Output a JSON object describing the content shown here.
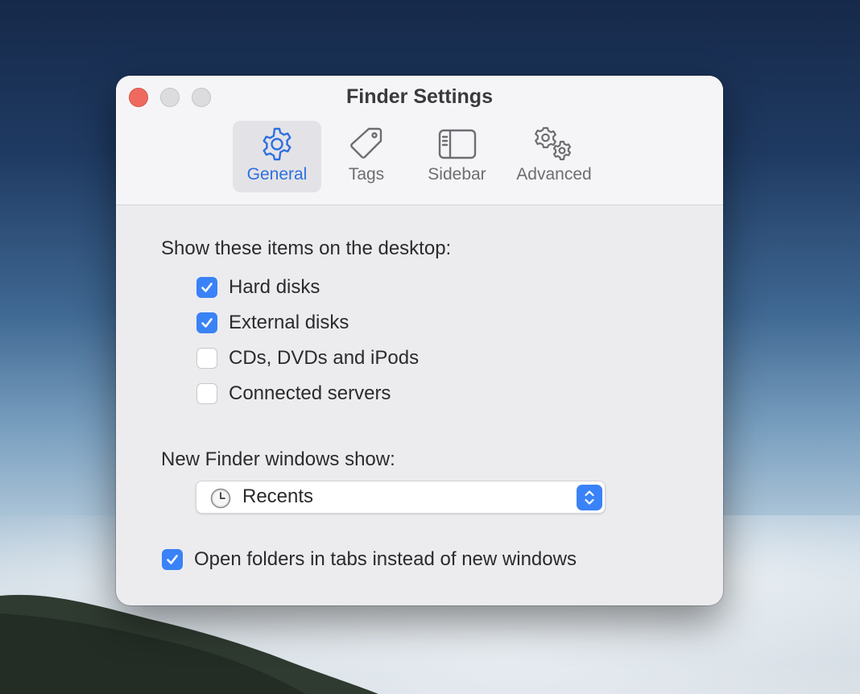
{
  "window": {
    "title": "Finder Settings"
  },
  "tabs": [
    {
      "label": "General",
      "icon": "gear-icon",
      "active": true
    },
    {
      "label": "Tags",
      "icon": "tag-icon",
      "active": false
    },
    {
      "label": "Sidebar",
      "icon": "sidebar-icon",
      "active": false
    },
    {
      "label": "Advanced",
      "icon": "gears-icon",
      "active": false
    }
  ],
  "general": {
    "desktop_items_heading": "Show these items on the desktop:",
    "desktop_items": [
      {
        "label": "Hard disks",
        "checked": true
      },
      {
        "label": "External disks",
        "checked": true
      },
      {
        "label": "CDs, DVDs and iPods",
        "checked": false
      },
      {
        "label": "Connected servers",
        "checked": false
      }
    ],
    "new_windows_heading": "New Finder windows show:",
    "new_windows_value": "Recents",
    "new_windows_icon": "clock-icon",
    "open_in_tabs": {
      "label": "Open folders in tabs instead of new windows",
      "checked": true
    }
  },
  "colors": {
    "accent": "#3a82f7",
    "close_button": "#ee6a5f",
    "active_tab_text": "#2f6fe0"
  }
}
